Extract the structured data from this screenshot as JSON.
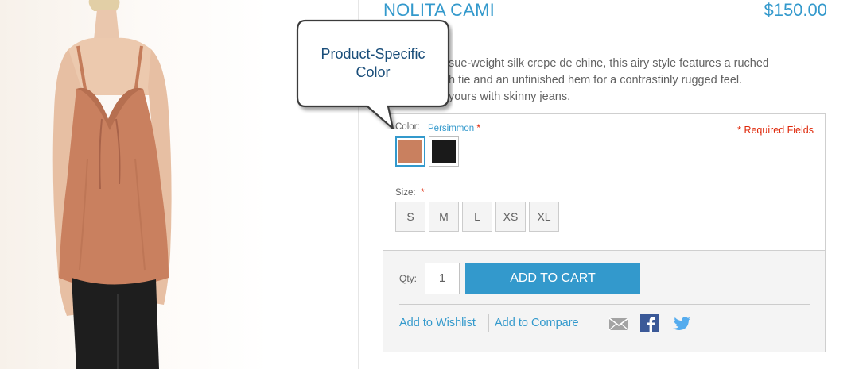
{
  "product": {
    "title": "NOLITA CAMI",
    "price": "$150.00",
    "description_lines": [
      "sue-weight silk crepe de chine, this airy style features a ruched",
      "h tie and an unfinished hem for a contrastinly rugged feel.",
      "yours with skinny jeans."
    ]
  },
  "callout": {
    "line1": "Product-Specific",
    "line2": "Color"
  },
  "options": {
    "color_label": "Color:",
    "color_value": "Persimmon",
    "required_star": "*",
    "required_note": "* Required Fields",
    "swatches": [
      {
        "name": "Persimmon",
        "color": "#c9805f",
        "selected": true
      },
      {
        "name": "Black",
        "color": "#1a1a1a",
        "selected": false
      }
    ],
    "size_label": "Size:",
    "sizes": [
      "S",
      "M",
      "L",
      "XS",
      "XL"
    ]
  },
  "cart": {
    "qty_label": "Qty:",
    "qty_value": "1",
    "add_label": "ADD TO CART",
    "wishlist_label": "Add to Wishlist",
    "compare_label": "Add to Compare"
  },
  "social": {
    "icons": [
      "email-icon",
      "facebook-icon",
      "twitter-icon"
    ]
  },
  "colors": {
    "accent": "#3399cc",
    "required": "#df280a",
    "text": "#636363",
    "facebook": "#3b5998",
    "twitter": "#55acee"
  }
}
